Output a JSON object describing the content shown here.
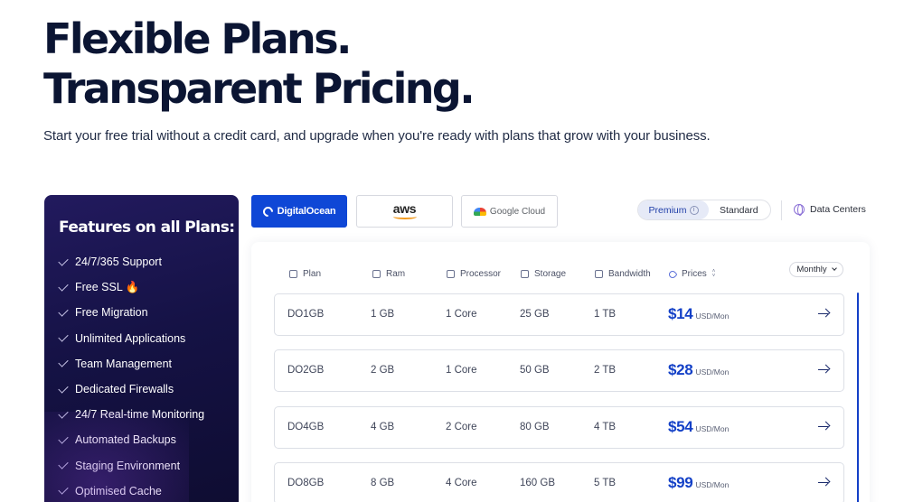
{
  "hero": {
    "title_line1": "Flexible Plans.",
    "title_line2": "Transparent Pricing.",
    "subtitle": "Start your free trial without a credit card, and upgrade when you're ready with plans that grow with your business."
  },
  "features": {
    "title": "Features on all Plans:",
    "items": [
      "24/7/365 Support",
      "Free SSL 🔥",
      "Free Migration",
      "Unlimited Applications",
      "Team Management",
      "Dedicated Firewalls",
      "24/7 Real-time Monitoring",
      "Automated Backups",
      "Staging Environment",
      "Optimised Cache"
    ]
  },
  "providers": {
    "digitalocean": "DigitalOcean",
    "aws": "aws",
    "google": "Google Cloud",
    "active": "DigitalOcean",
    "active_color": "#0f47d6"
  },
  "tier_toggle": {
    "premium": "Premium",
    "standard": "Standard",
    "selected": "Premium",
    "info_glyph": "i"
  },
  "data_centers": "Data Centers",
  "table": {
    "headers": {
      "plan": "Plan",
      "ram": "Ram",
      "processor": "Processor",
      "storage": "Storage",
      "bandwidth": "Bandwidth",
      "prices": "Prices"
    },
    "billing": "Monthly",
    "sort_up": "˄",
    "sort_down": "˅",
    "price_color": "#1340c7",
    "rows": [
      {
        "plan": "DO1GB",
        "ram": "1 GB",
        "processor": "1 Core",
        "storage": "25 GB",
        "bandwidth": "1 TB",
        "price": "$14",
        "unit": "USD/Mon"
      },
      {
        "plan": "DO2GB",
        "ram": "2 GB",
        "processor": "1 Core",
        "storage": "50 GB",
        "bandwidth": "2 TB",
        "price": "$28",
        "unit": "USD/Mon"
      },
      {
        "plan": "DO4GB",
        "ram": "4 GB",
        "processor": "2 Core",
        "storage": "80 GB",
        "bandwidth": "4 TB",
        "price": "$54",
        "unit": "USD/Mon"
      },
      {
        "plan": "DO8GB",
        "ram": "8 GB",
        "processor": "4 Core",
        "storage": "160 GB",
        "bandwidth": "5 TB",
        "price": "$99",
        "unit": "USD/Mon"
      }
    ]
  }
}
